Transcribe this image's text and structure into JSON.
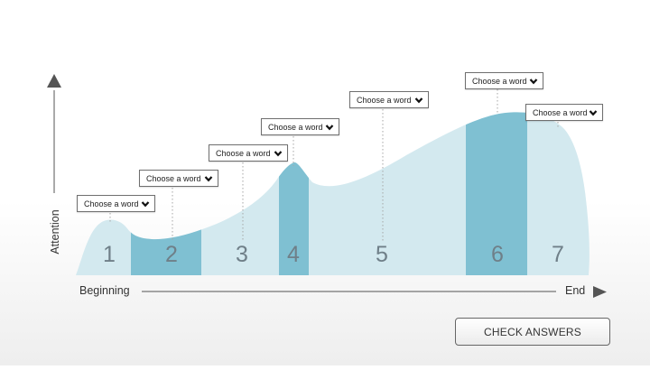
{
  "chart": {
    "y_axis_label": "Attention",
    "x_start_label": "Beginning",
    "x_end_label": "End"
  },
  "segments": [
    {
      "number": "1",
      "highlighted": false
    },
    {
      "number": "2",
      "highlighted": true
    },
    {
      "number": "3",
      "highlighted": false
    },
    {
      "number": "4",
      "highlighted": true
    },
    {
      "number": "5",
      "highlighted": false
    },
    {
      "number": "6",
      "highlighted": true
    },
    {
      "number": "7",
      "highlighted": false
    }
  ],
  "dropdowns": [
    {
      "value": "Choose a word"
    },
    {
      "value": "Choose a word"
    },
    {
      "value": "Choose a word"
    },
    {
      "value": "Choose a word"
    },
    {
      "value": "Choose a word"
    },
    {
      "value": "Choose a word"
    },
    {
      "value": "Choose a word"
    }
  ],
  "check_button_label": "CHECK ANSWERS",
  "colors": {
    "curve_fill": "#d3e9ef",
    "highlight_fill": "#7fc0d2",
    "axis": "#555555",
    "dashed_leader": "#a6a6a6"
  },
  "icons": {
    "dropdown": "chevron-down-icon",
    "y_axis": "arrow-up-icon",
    "x_axis": "arrow-right-icon"
  }
}
